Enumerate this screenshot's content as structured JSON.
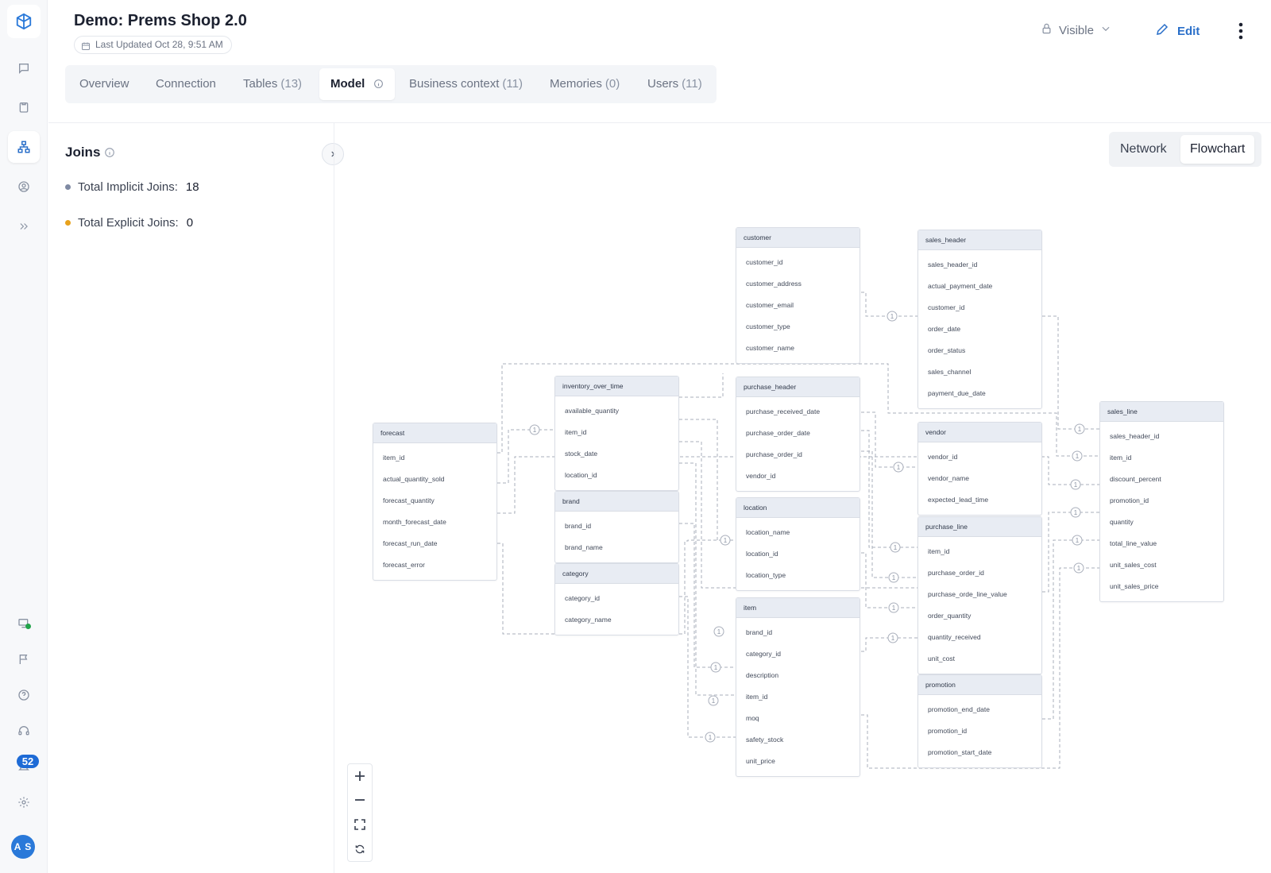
{
  "page": {
    "title": "Demo: Prems Shop 2.0",
    "last_updated": "Last Updated Oct 28, 9:51 AM",
    "visibility": "Visible",
    "edit_label": "Edit"
  },
  "tabs": [
    {
      "label": "Overview",
      "count": ""
    },
    {
      "label": "Connection",
      "count": ""
    },
    {
      "label": "Tables",
      "count": "(13)"
    },
    {
      "label": "Model",
      "count": ""
    },
    {
      "label": "Business context",
      "count": "(11)"
    },
    {
      "label": "Memories",
      "count": "(0)"
    },
    {
      "label": "Users",
      "count": "(11)"
    }
  ],
  "active_tab": "Model",
  "sidebar": {
    "notification_count": "52",
    "avatar_initials": "A S"
  },
  "joins": {
    "title": "Joins",
    "implicit_label": "Total Implicit Joins:",
    "implicit_value": "18",
    "explicit_label": "Total Explicit Joins:",
    "explicit_value": "0",
    "implicit_color": "#7f8aa3",
    "explicit_color": "#e8a21c"
  },
  "view_toggle": {
    "options": [
      "Network",
      "Flowchart"
    ],
    "selected": "Flowchart"
  },
  "relation_marker": "1",
  "tables": [
    {
      "name": "customer",
      "fields": [
        "customer_id",
        "customer_address",
        "customer_email",
        "customer_type",
        "customer_name"
      ]
    },
    {
      "name": "sales_header",
      "fields": [
        "sales_header_id",
        "actual_payment_date",
        "customer_id",
        "order_date",
        "order_status",
        "sales_channel",
        "payment_due_date"
      ]
    },
    {
      "name": "inventory_over_time",
      "fields": [
        "available_quantity",
        "item_id",
        "stock_date",
        "location_id"
      ]
    },
    {
      "name": "purchase_header",
      "fields": [
        "purchase_received_date",
        "purchase_order_date",
        "purchase_order_id",
        "vendor_id"
      ]
    },
    {
      "name": "forecast",
      "fields": [
        "item_id",
        "actual_quantity_sold",
        "forecast_quantity",
        "month_forecast_date",
        "forecast_run_date",
        "forecast_error"
      ]
    },
    {
      "name": "vendor",
      "fields": [
        "vendor_id",
        "vendor_name",
        "expected_lead_time"
      ]
    },
    {
      "name": "sales_line",
      "fields": [
        "sales_header_id",
        "item_id",
        "discount_percent",
        "promotion_id",
        "quantity",
        "total_line_value",
        "unit_sales_cost",
        "unit_sales_price"
      ]
    },
    {
      "name": "brand",
      "fields": [
        "brand_id",
        "brand_name"
      ]
    },
    {
      "name": "location",
      "fields": [
        "location_name",
        "location_id",
        "location_type"
      ]
    },
    {
      "name": "purchase_line",
      "fields": [
        "item_id",
        "purchase_order_id",
        "purchase_orde_line_value",
        "order_quantity",
        "quantity_received",
        "unit_cost"
      ]
    },
    {
      "name": "category",
      "fields": [
        "category_id",
        "category_name"
      ]
    },
    {
      "name": "item",
      "fields": [
        "brand_id",
        "category_id",
        "description",
        "item_id",
        "moq",
        "safety_stock",
        "unit_price"
      ]
    },
    {
      "name": "promotion",
      "fields": [
        "promotion_end_date",
        "promotion_id",
        "promotion_start_date"
      ]
    }
  ]
}
